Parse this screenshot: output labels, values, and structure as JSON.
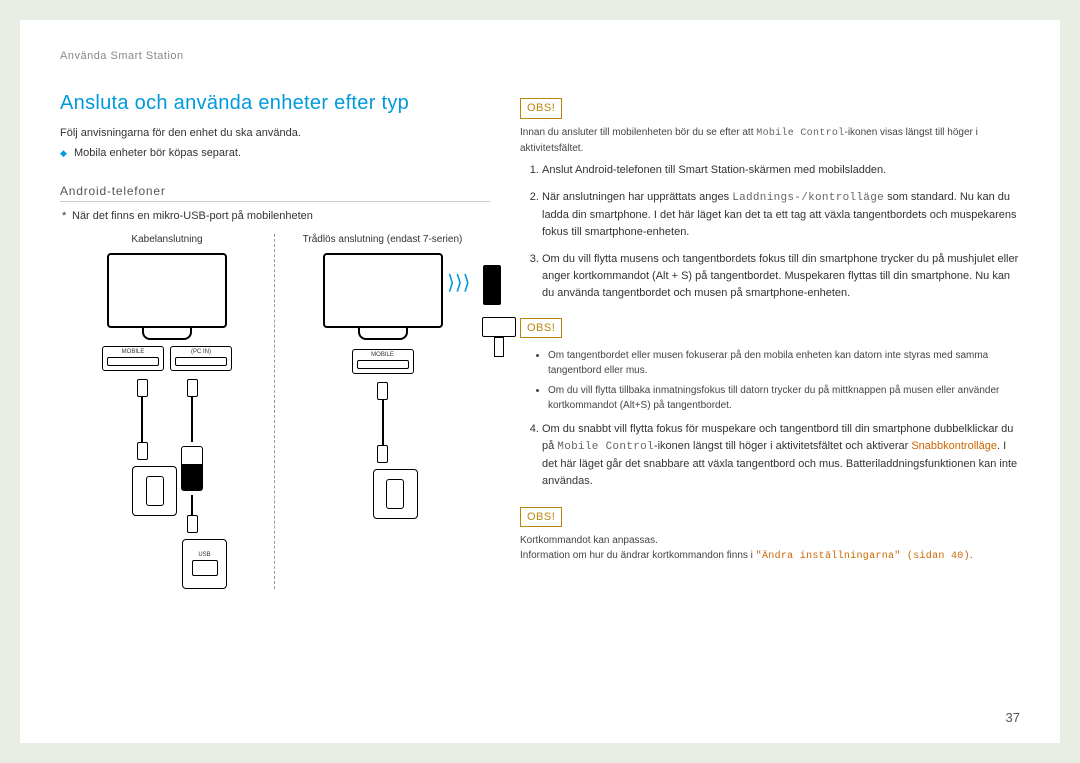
{
  "breadcrumb": "Använda Smart Station",
  "title": "Ansluta och använda enheter efter typ",
  "intro": "Följ anvisningarna för den enhet du ska använda.",
  "purchase_note": "Mobila enheter bör köpas separat.",
  "subheading": "Android-telefoner",
  "usb_note": "När det finns en mikro-USB-port på mobilenheten",
  "diagram_left_title": "Kabelanslutning",
  "diagram_right_title": "Trådlös anslutning (endast 7-serien)",
  "port_mobile": "MOBILE",
  "port_pcin": "(PC IN)",
  "usb_label": "USB",
  "obs_label": "OBS!",
  "obs1_text_a": "Innan du ansluter till mobilenheten bör du se efter att ",
  "obs1_text_b": "Mobile Control",
  "obs1_text_c": "-ikonen visas längst till höger i aktivitetsfältet.",
  "step1": "Anslut Android-telefonen till Smart Station-skärmen med mobilsladden.",
  "step2_a": "När anslutningen har upprättats anges ",
  "step2_b": "Laddnings-/kontrolläge",
  "step2_c": " som standard. Nu kan du ladda din smartphone. I det här läget kan det ta ett tag att växla tangentbordets och muspekarens fokus till smartphone-enheten.",
  "step3": "Om du vill flytta musens och tangentbordets fokus till din smartphone trycker du på mushjulet eller anger kortkommandot (Alt + S) på tangentbordet. Muspekaren flyttas till din smartphone. Nu kan du använda tangentbordet och musen på smartphone-enheten.",
  "obs2_bullet1": "Om tangentbordet eller musen fokuserar på den mobila enheten kan datorn inte styras med samma tangentbord eller mus.",
  "obs2_bullet2": "Om du vill flytta tillbaka inmatningsfokus till datorn trycker du på mittknappen på musen eller använder kortkommandot (Alt+S) på tangentbordet.",
  "step4_a": "Om du snabbt vill flytta fokus för muspekare och tangentbord till din smartphone dubbelklickar du på ",
  "step4_b": "Mobile Control",
  "step4_c": "-ikonen längst till höger i aktivitetsfältet och aktiverar ",
  "step4_d": "Snabbkontrolläge",
  "step4_e": ". I det här läget går det snabbare att växla tangentbord och mus. Batteriladdningsfunktionen kan inte användas.",
  "obs3_line1": "Kortkommandot kan anpassas.",
  "obs3_line2_a": "Information om hur du ändrar kortkommandon finns i ",
  "obs3_line2_b": "\"Ändra inställningarna\" (sidan 40)",
  "obs3_line2_c": ".",
  "page_number": "37"
}
